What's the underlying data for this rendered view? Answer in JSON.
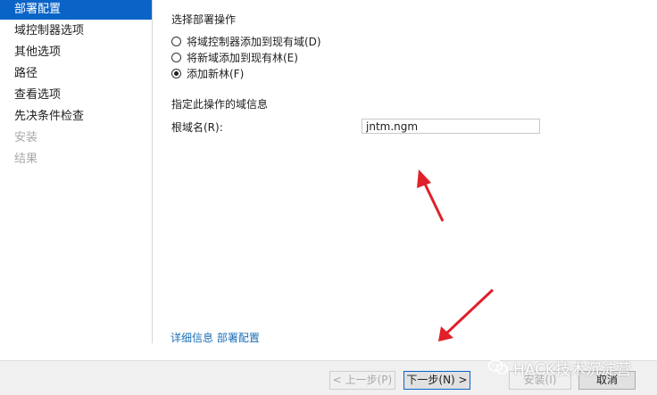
{
  "sidebar": {
    "items": [
      {
        "label": "部署配置",
        "state": "active"
      },
      {
        "label": "域控制器选项",
        "state": "normal"
      },
      {
        "label": "其他选项",
        "state": "normal"
      },
      {
        "label": "路径",
        "state": "normal"
      },
      {
        "label": "查看选项",
        "state": "normal"
      },
      {
        "label": "先决条件检查",
        "state": "normal"
      },
      {
        "label": "安装",
        "state": "disabled"
      },
      {
        "label": "结果",
        "state": "disabled"
      }
    ]
  },
  "deployment": {
    "section_title": "选择部署操作",
    "options": [
      {
        "label": "将域控制器添加到现有域(D)",
        "checked": false
      },
      {
        "label": "将新域添加到现有林(E)",
        "checked": false
      },
      {
        "label": "添加新林(F)",
        "checked": true
      }
    ]
  },
  "domain_info": {
    "section_title": "指定此操作的域信息",
    "root_domain_label": "根域名(R):",
    "root_domain_value": "jntm.ngm"
  },
  "more_info_link": "详细信息 部署配置",
  "footer": {
    "back_label": "< 上一步(P)",
    "next_label": "下一步(N) >",
    "install_label": "安装(I)",
    "cancel_label": "取消"
  },
  "watermark": {
    "text": "HACK技术沉淀营"
  },
  "colors": {
    "active_nav_bg": "#0a64c8",
    "link": "#1a6fb5",
    "annotation_arrow": "#e0202a"
  }
}
